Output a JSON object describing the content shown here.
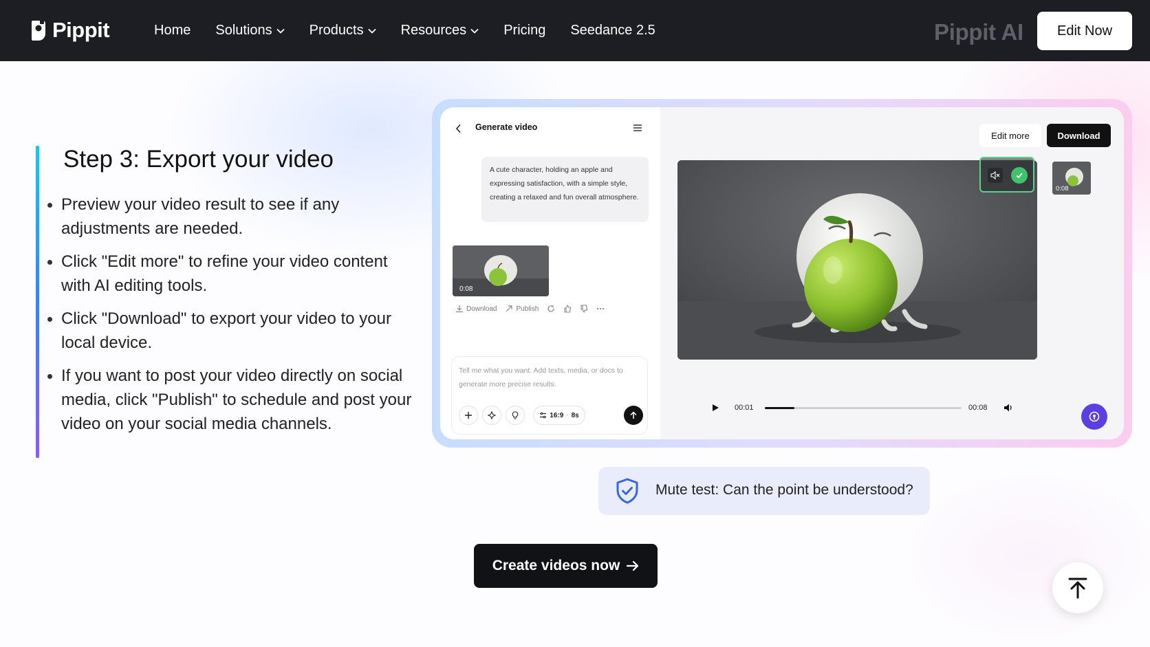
{
  "nav": {
    "logo_text": "Pippit",
    "links": [
      "Home",
      "Solutions",
      "Products",
      "Resources",
      "Pricing",
      "Seedance 2.5"
    ],
    "brand_ghost": "Pippit AI",
    "edit_now": "Edit Now"
  },
  "step": {
    "title": "Step 3: Export your video",
    "bullets": [
      "Preview your video result to see if any adjustments are needed.",
      "Click \"Edit more\" to refine your video content with AI editing tools.",
      "Click \"Download\" to export your video to your local device.",
      "If you want to post your video directly on social media, click \"Publish\" to schedule and post your video on your social media channels."
    ]
  },
  "demo": {
    "chat_title": "Generate video",
    "prompt": "A cute character, holding an apple and expressing satisfaction, with a simple style, creating a relaxed and fun overall atmosphere.",
    "thumb_time": "0:08",
    "actions": {
      "download": "Download",
      "publish": "Publish"
    },
    "input_placeholder": "Tell me what you want. Add texts, media, or docs to generate more precise results.",
    "ratio": "16:9",
    "duration": "8s",
    "edit_more": "Edit more",
    "download": "Download",
    "side_thumb_time": "0:08",
    "player": {
      "current": "00:01",
      "total": "00:08",
      "progress": 0.15
    }
  },
  "mute_banner": "Mute test: Can the point be understood?",
  "cta": "Create videos now",
  "colors": {
    "nav_bg": "#1c1e24",
    "accent_purple": "#5b3fe0",
    "check_green": "#3ec36b",
    "shield_blue": "#3a64e8"
  },
  "icons": [
    "chevron-down-icon",
    "back-icon",
    "menu-icon",
    "mute-icon",
    "check-icon",
    "play-icon",
    "volume-icon",
    "shield-icon",
    "arrow-right-icon",
    "arrow-up-icon"
  ]
}
